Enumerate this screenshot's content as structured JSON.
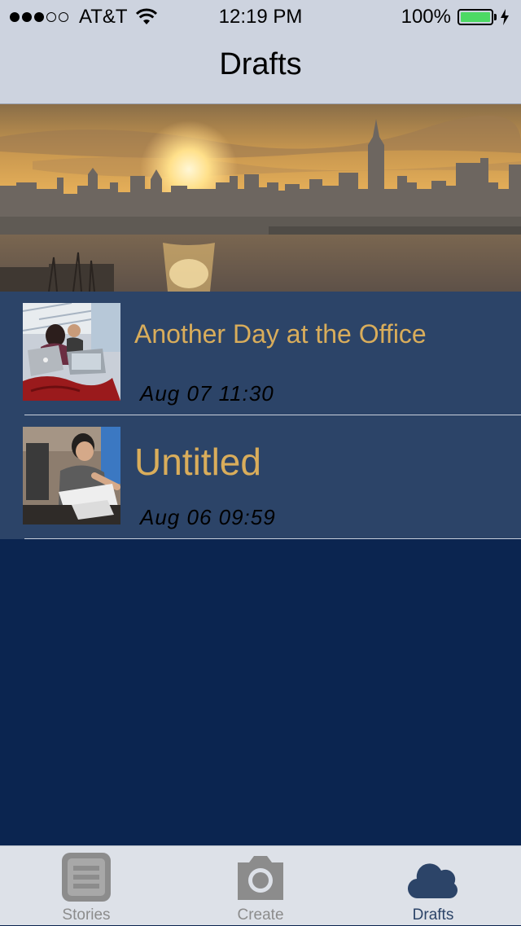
{
  "status_bar": {
    "carrier": "AT&T",
    "signal_bars_filled": 3,
    "signal_bars_total": 5,
    "time": "12:19 PM",
    "battery_percent": "100%",
    "battery_level": 1.0,
    "battery_color": "#4cd964",
    "icons": [
      "wifi-icon",
      "battery-icon",
      "charging-bolt-icon"
    ]
  },
  "nav": {
    "title": "Drafts"
  },
  "hero": {
    "image": "city-skyline-sunset"
  },
  "drafts": [
    {
      "title": "Another Day at the Office",
      "date": "Aug 07 11:30",
      "thumbnail": "office-laptops-photo"
    },
    {
      "title": "Untitled",
      "date": "Aug 06 09:59",
      "thumbnail": "man-at-desk-photo"
    }
  ],
  "tab_bar": {
    "tabs": [
      {
        "label": "Stories",
        "icon": "list-icon",
        "active": false
      },
      {
        "label": "Create",
        "icon": "camera-icon",
        "active": false
      },
      {
        "label": "Drafts",
        "icon": "cloud-icon",
        "active": true
      }
    ]
  },
  "colors": {
    "bar_background": "#cdd3df",
    "page_background": "#0b2550",
    "row_background": "#2c4468",
    "title_text": "#d9ad5b",
    "tab_active": "#2c4468",
    "tab_inactive": "#8c8c8c"
  }
}
